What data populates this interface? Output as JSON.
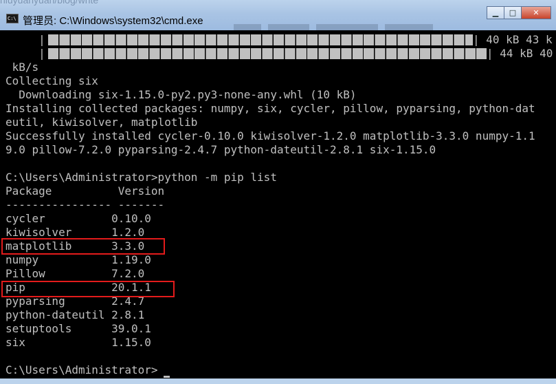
{
  "window": {
    "background_url": "niuyuanyuan/blog/write",
    "title": "管理员: C:\\Windows\\system32\\cmd.exe",
    "icon_label": "C:\\",
    "minimize_glyph": "▁",
    "maximize_glyph": "□",
    "close_glyph": "✕"
  },
  "console": {
    "progress_lines": [
      {
        "prefix": "     |",
        "suffix": "| 40 kB 43 k"
      },
      {
        "prefix": "     |",
        "suffix": "| 44 kB 40"
      }
    ],
    "lines": [
      " kB/s",
      "Collecting six",
      "  Downloading six-1.15.0-py2.py3-none-any.whl (10 kB)",
      "Installing collected packages: numpy, six, cycler, pillow, pyparsing, python-dat",
      "eutil, kiwisolver, matplotlib",
      "Successfully installed cycler-0.10.0 kiwisolver-1.2.0 matplotlib-3.3.0 numpy-1.1",
      "9.0 pillow-7.2.0 pyparsing-2.4.7 python-dateutil-2.8.1 six-1.15.0",
      "",
      "C:\\Users\\Administrator>python -m pip list",
      "Package          Version",
      "---------------- -------",
      "cycler          0.10.0",
      "kiwisolver      1.2.0",
      "matplotlib      3.3.0",
      "numpy           1.19.0",
      "Pillow          7.2.0",
      "pip             20.1.1",
      "pyparsing       2.4.7",
      "python-dateutil 2.8.1",
      "setuptools      39.0.1",
      "six             1.15.0",
      "",
      "C:\\Users\\Administrator>"
    ],
    "highlighted_packages": [
      "matplotlib",
      "pip"
    ]
  },
  "colors": {
    "console_bg": "#000000",
    "console_text": "#c0c0c0",
    "highlight_border": "#e41b1b"
  }
}
